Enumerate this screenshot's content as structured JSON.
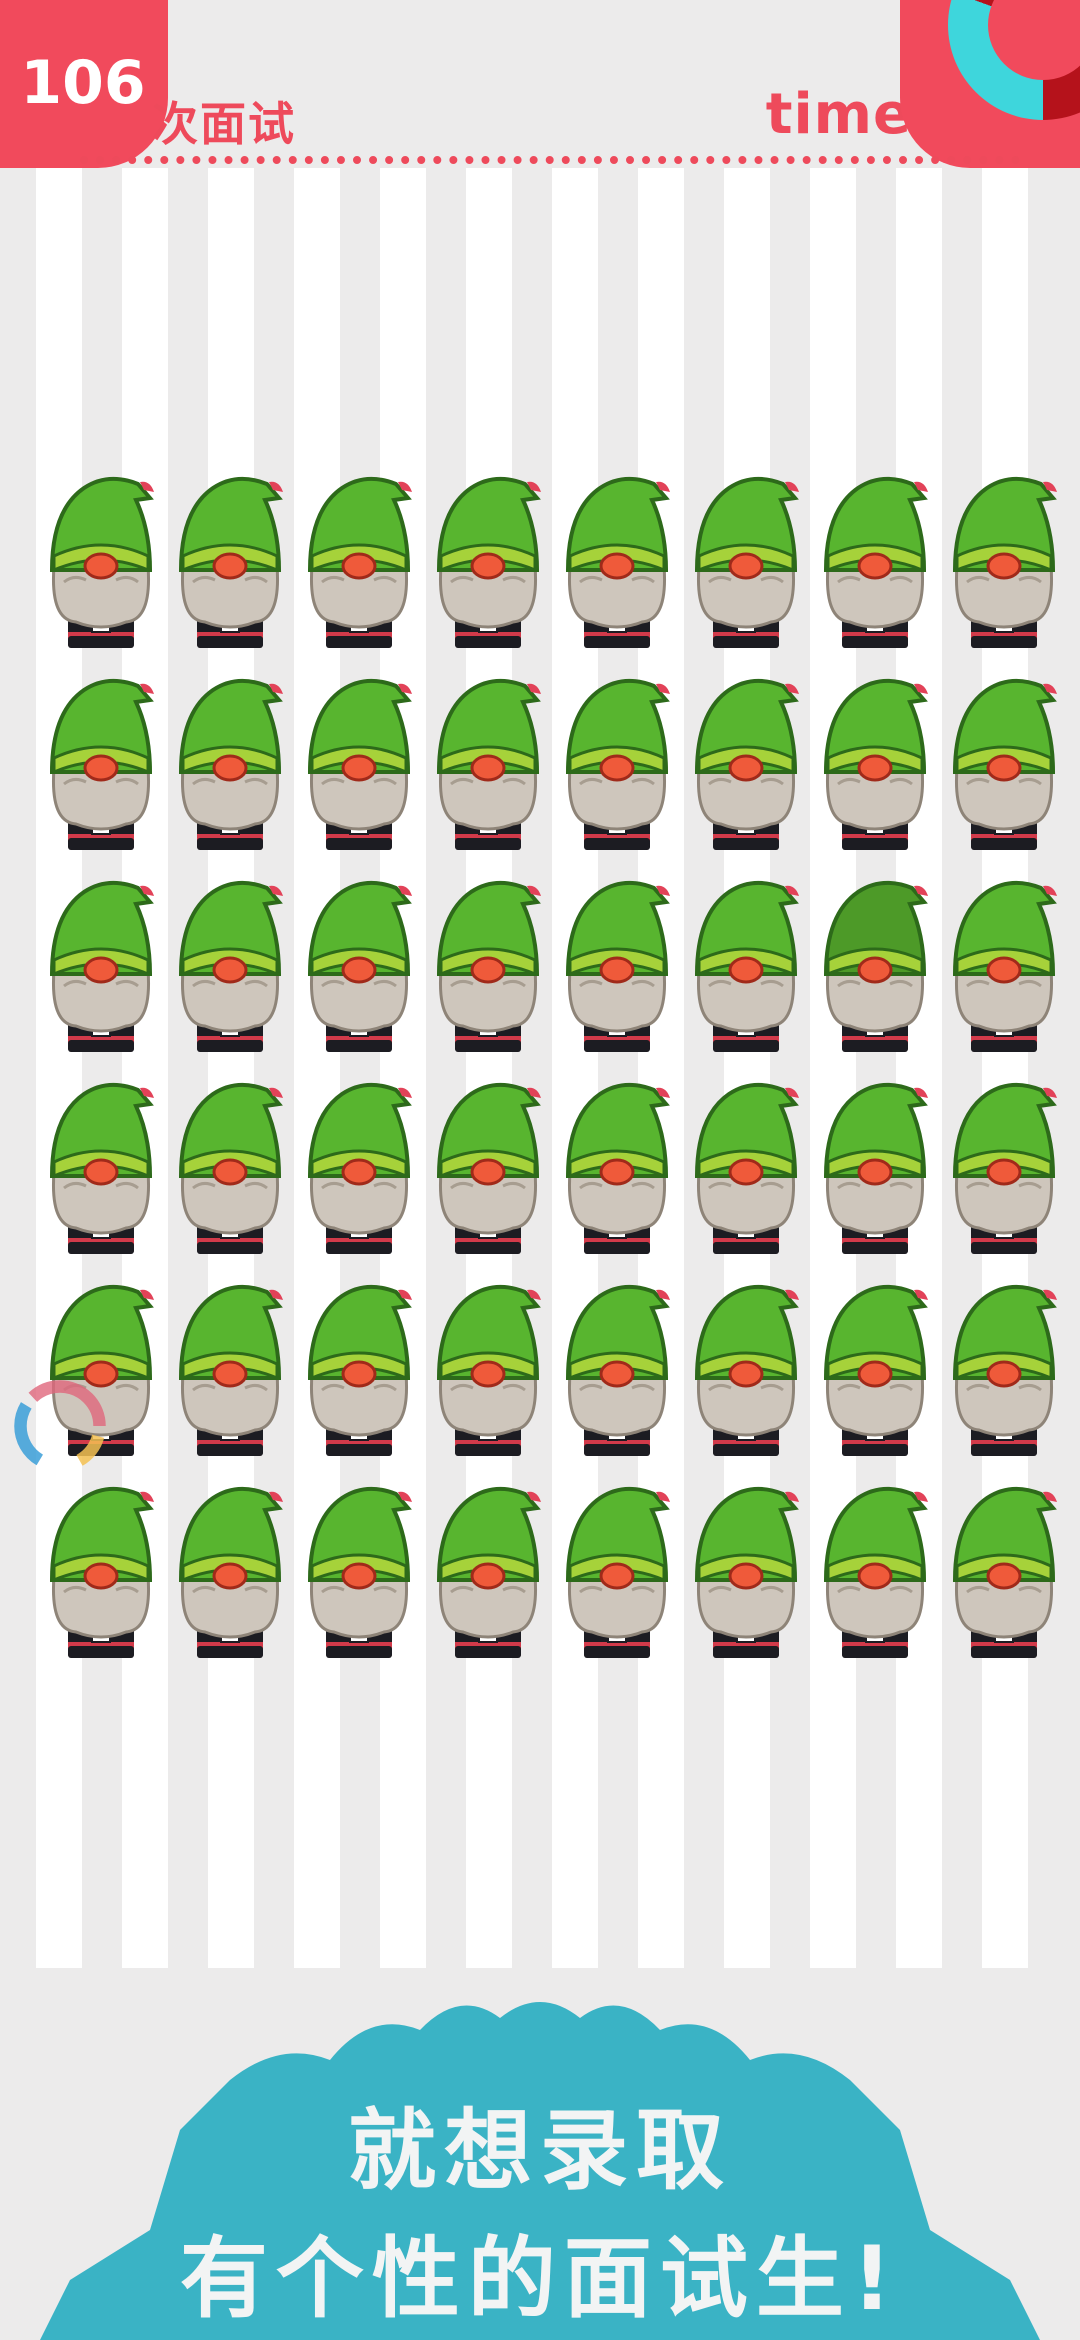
{
  "header": {
    "level_number": "106",
    "level_suffix": "次面试",
    "time_label": "time"
  },
  "grid": {
    "rows": 6,
    "columns": 8,
    "item": "gnome",
    "odd_one_out": {
      "row": 3,
      "column": 7,
      "difference": "darker hat"
    }
  },
  "banner": {
    "line1": "就想录取",
    "line2": "有个性的面试生!"
  },
  "colors": {
    "accent_red": "#f14a5c",
    "hat_green": "#58b52f",
    "hat_band": "#a6d23a",
    "hat_odd": "#4d9a28",
    "beard": "#cec6bc",
    "nose": "#ef5a3a",
    "banner_teal": "#3ab3c5",
    "timer_cyan": "#3ed6dc",
    "background": "#ecebeb"
  },
  "icons": {
    "loading": "loading-spinner-icon",
    "timer": "timer-ring-icon"
  }
}
